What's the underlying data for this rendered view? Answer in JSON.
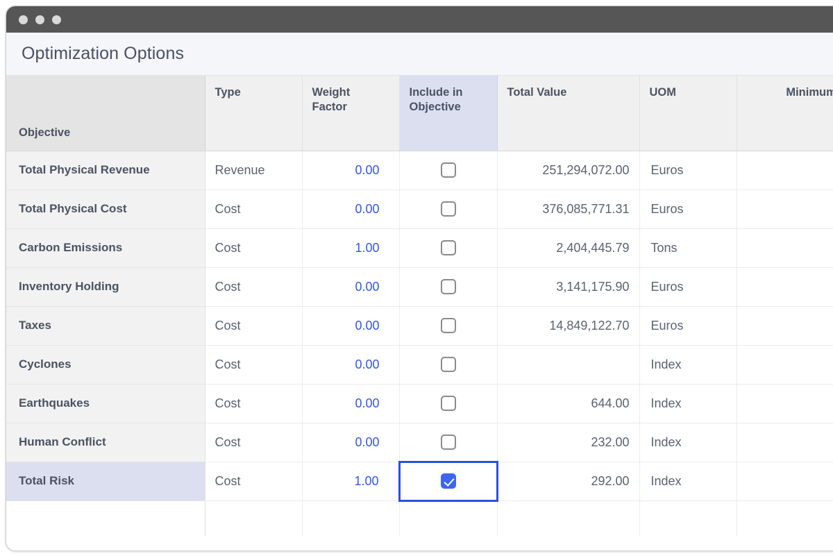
{
  "window": {
    "traffic_lights": [
      "close-dot",
      "minimize-dot",
      "maximize-dot"
    ],
    "accent_color": "#3a66f0",
    "selection_color": "#dcdff0",
    "titlebar_color": "#565656"
  },
  "panel": {
    "title": "Optimization Options"
  },
  "table": {
    "corner_header": "Objective",
    "columns": [
      {
        "key": "type",
        "label": "Type"
      },
      {
        "key": "weight_factor",
        "label": "Weight Factor"
      },
      {
        "key": "include_in_objective",
        "label": "Include in Objective",
        "selected": true
      },
      {
        "key": "total_value",
        "label": "Total Value"
      },
      {
        "key": "uom",
        "label": "UOM"
      },
      {
        "key": "minimum_req",
        "label": "Minimum Req"
      }
    ],
    "rows": [
      {
        "objective": "Total Physical Revenue",
        "type": "Revenue",
        "weight_factor": "0.00",
        "include_in_objective": false,
        "total_value": "251,294,072.00",
        "uom": "Euros",
        "minimum_req": "",
        "selected": false,
        "focused_cell": false
      },
      {
        "objective": "Total Physical Cost",
        "type": "Cost",
        "weight_factor": "0.00",
        "include_in_objective": false,
        "total_value": "376,085,771.31",
        "uom": "Euros",
        "minimum_req": "",
        "selected": false,
        "focused_cell": false
      },
      {
        "objective": "Carbon Emissions",
        "type": "Cost",
        "weight_factor": "1.00",
        "include_in_objective": false,
        "total_value": "2,404,445.79",
        "uom": "Tons",
        "minimum_req": "",
        "selected": false,
        "focused_cell": false
      },
      {
        "objective": "Inventory Holding",
        "type": "Cost",
        "weight_factor": "0.00",
        "include_in_objective": false,
        "total_value": "3,141,175.90",
        "uom": "Euros",
        "minimum_req": "",
        "selected": false,
        "focused_cell": false
      },
      {
        "objective": "Taxes",
        "type": "Cost",
        "weight_factor": "0.00",
        "include_in_objective": false,
        "total_value": "14,849,122.70",
        "uom": "Euros",
        "minimum_req": "",
        "selected": false,
        "focused_cell": false
      },
      {
        "objective": "Cyclones",
        "type": "Cost",
        "weight_factor": "0.00",
        "include_in_objective": false,
        "total_value": "",
        "uom": "Index",
        "minimum_req": "",
        "selected": false,
        "focused_cell": false
      },
      {
        "objective": "Earthquakes",
        "type": "Cost",
        "weight_factor": "0.00",
        "include_in_objective": false,
        "total_value": "644.00",
        "uom": "Index",
        "minimum_req": "",
        "selected": false,
        "focused_cell": false
      },
      {
        "objective": "Human Conflict",
        "type": "Cost",
        "weight_factor": "0.00",
        "include_in_objective": false,
        "total_value": "232.00",
        "uom": "Index",
        "minimum_req": "",
        "selected": false,
        "focused_cell": false
      },
      {
        "objective": "Total Risk",
        "type": "Cost",
        "weight_factor": "1.00",
        "include_in_objective": true,
        "total_value": "292.00",
        "uom": "Index",
        "minimum_req": "",
        "selected": true,
        "focused_cell": true
      }
    ]
  }
}
